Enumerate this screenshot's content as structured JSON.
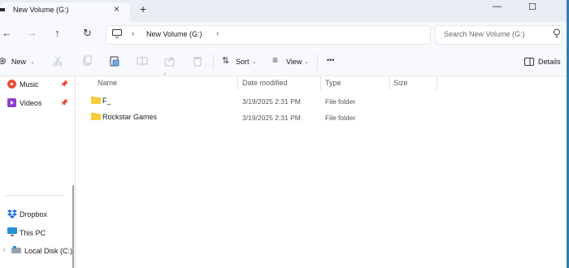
{
  "window": {
    "tab_title": "New Volume (G:)",
    "tab_close": "×",
    "new_tab": "+",
    "minimize": "—",
    "maximize": "☐"
  },
  "nav": {
    "back": "←",
    "forward": "→",
    "up": "↑",
    "refresh": "↻",
    "breadcrumb_sep": "›",
    "breadcrumb_current": "New Volume (G:)",
    "breadcrumb_more": "›",
    "search_placeholder": "Search New Volume (G:)"
  },
  "commands": {
    "new": "New",
    "sort": "Sort",
    "view": "View",
    "more": "•••",
    "details": "Details"
  },
  "sidebar": {
    "quick_access": [
      {
        "label": "Music",
        "icon": "music-icon",
        "pinned": true
      },
      {
        "label": "Videos",
        "icon": "videos-icon",
        "pinned": true
      }
    ],
    "locations": [
      {
        "label": "Dropbox",
        "icon": "dropbox-icon"
      },
      {
        "label": "This PC",
        "icon": "this-pc-icon"
      },
      {
        "label": "Local Disk (C:)",
        "icon": "local-disk-icon"
      }
    ]
  },
  "columns": [
    "Name",
    "Date modified",
    "Type",
    "Size"
  ],
  "files": [
    {
      "name": "F_",
      "date_modified": "3/19/2025 2:31 PM",
      "type": "File folder",
      "size": ""
    },
    {
      "name": "Rockstar Games",
      "date_modified": "3/19/2025 2:31 PM",
      "type": "File folder",
      "size": ""
    }
  ],
  "colors": {
    "titlebar_bg": "#e9eef5",
    "surface_bg": "#f7f9fc",
    "folder_yellow": "#f5c518",
    "accent_edge": "#2f7fb8"
  }
}
